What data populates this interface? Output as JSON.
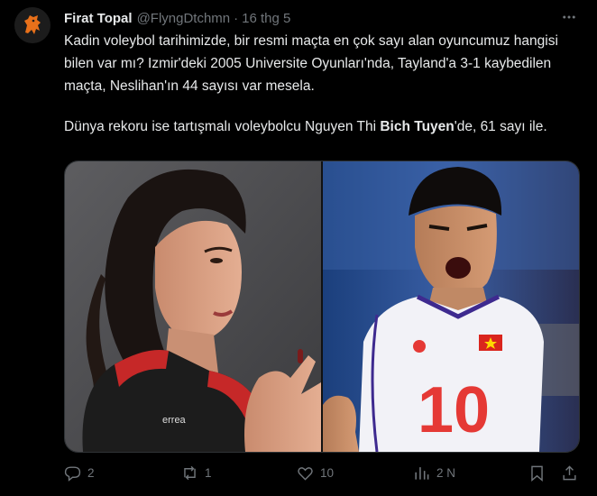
{
  "tweet": {
    "author_name": "Firat Topal",
    "author_handle": "@FlyngDtchmn",
    "separator": "·",
    "date": "16 thg 5",
    "paragraph1": "Kadin voleybol tarihimizde, bir resmi maçta en çok sayı alan oyuncumuz hangisi bilen var mı? Izmir'deki 2005 Universite Oyunları'nda, Tayland'a 3-1 kaybedilen maçta, Neslihan'ın 44 sayısı var mesela.",
    "paragraph2_before": "Dünya rekoru ise tartışmalı voleybolcu Nguyen Thi ",
    "paragraph2_bold": "Bich Tuyen",
    "paragraph2_after": "'de, 61 sayı ile."
  },
  "media": {
    "right_jersey_number": "10",
    "left_jersey_brand": "errea"
  },
  "actions": {
    "replies": "2",
    "reposts": "1",
    "likes": "10",
    "views": "2 N"
  },
  "icons": {
    "more": "more-horizontal-icon",
    "reply": "reply-icon",
    "repost": "repost-icon",
    "like": "like-icon",
    "views": "views-icon",
    "bookmark": "bookmark-icon",
    "share": "share-icon"
  },
  "colors": {
    "background": "#000000",
    "text": "#e7e9ea",
    "muted": "#71767b",
    "border": "#2f3336",
    "avatar_accent": "#e8701a"
  }
}
